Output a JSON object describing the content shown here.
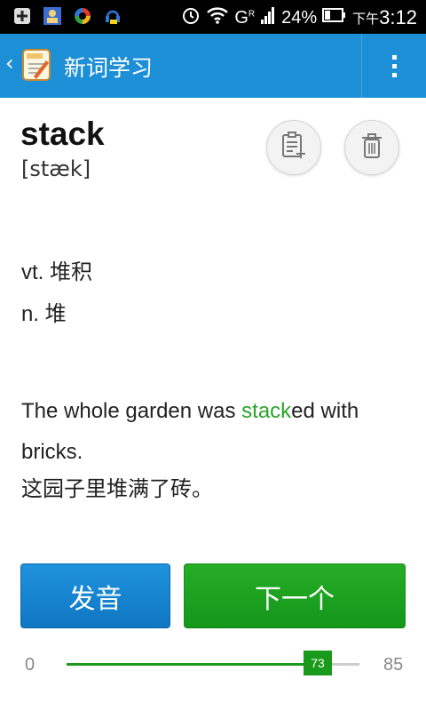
{
  "status_bar": {
    "icons_left": [
      "plus-notification-icon",
      "contact-card-icon",
      "sync-app-icon",
      "tts-app-icon"
    ],
    "icons_right": [
      "alarm-icon",
      "wifi-icon",
      "signal-icon",
      "battery-icon"
    ],
    "network_type": "G",
    "roaming": "R",
    "battery": "24%",
    "ampm": "下午",
    "time": "3:12"
  },
  "appbar": {
    "back_glyph": "‹",
    "title": "新词学习",
    "bg_color": "#1c8fd7"
  },
  "word": {
    "headword": "stack",
    "phonetic": "[stæk]"
  },
  "actions": {
    "add_icon": "add-to-wordbook-icon",
    "delete_icon": "trash-icon"
  },
  "definitions": [
    "vt. 堆积",
    "n. 堆"
  ],
  "example": {
    "prefix": "The whole garden was ",
    "highlight": "stack",
    "suffix": "ed with bricks.",
    "highlight_color": "#2aa52a",
    "translation": "这园子里堆满了砖。"
  },
  "buttons": {
    "pronounce": "发音",
    "next": "下一个"
  },
  "progress": {
    "min": "0",
    "value": "73",
    "max": "85",
    "fill_color": "#1a9a1a"
  }
}
